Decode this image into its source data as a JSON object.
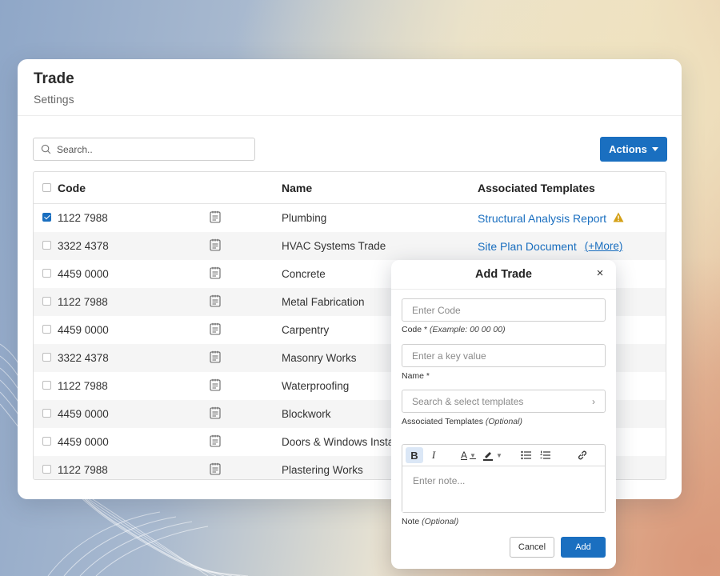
{
  "header": {
    "title": "Trade",
    "subtitle": "Settings"
  },
  "search": {
    "placeholder": "Search.."
  },
  "actions": {
    "label": "Actions"
  },
  "table": {
    "columns": {
      "code": "Code",
      "name": "Name",
      "templates": "Associated Templates"
    },
    "rows": [
      {
        "code": "1122 7988",
        "name": "Plumbing",
        "template": "Structural Analysis Report",
        "more": "",
        "checked": true,
        "warning": true
      },
      {
        "code": "3322 4378",
        "name": "HVAC Systems Trade",
        "template": "Site Plan Document",
        "more": "(+More)",
        "checked": false,
        "warning": false
      },
      {
        "code": "4459 0000",
        "name": "Concrete",
        "template": "",
        "more": "",
        "checked": false,
        "warning": false
      },
      {
        "code": "1122 7988",
        "name": "Metal Fabrication",
        "template": "",
        "more": "",
        "checked": false,
        "warning": false
      },
      {
        "code": "4459 0000",
        "name": "Carpentry",
        "template": "",
        "more": "",
        "checked": false,
        "warning": false
      },
      {
        "code": "3322 4378",
        "name": "Masonry Works",
        "template": "",
        "more": "",
        "checked": false,
        "warning": false
      },
      {
        "code": "1122 7988",
        "name": "Waterproofing",
        "template": "",
        "more": "",
        "checked": false,
        "warning": false
      },
      {
        "code": "4459 0000",
        "name": "Blockwork",
        "template": "",
        "more": "",
        "checked": false,
        "warning": false
      },
      {
        "code": "4459 0000",
        "name": "Doors & Windows Insta",
        "template": "",
        "more": "",
        "checked": false,
        "warning": false
      },
      {
        "code": "1122 7988",
        "name": "Plastering Works",
        "template": "",
        "more": "",
        "checked": false,
        "warning": false
      }
    ]
  },
  "modal": {
    "title": "Add Trade",
    "close": "×",
    "code_placeholder": "Enter Code",
    "code_label": "Code *",
    "code_hint": "(Example: 00 00 00)",
    "name_placeholder": "Enter a key value",
    "name_label": "Name *",
    "templates_placeholder": "Search & select templates",
    "templates_label": "Associated Templates",
    "templates_hint": "(Optional)",
    "note_placeholder": "Enter note...",
    "note_label": "Note",
    "note_hint": "(Optional)",
    "cancel_label": "Cancel",
    "add_label": "Add",
    "toolbar": {
      "bold": "B",
      "italic": "I",
      "text_color": "A"
    }
  },
  "colors": {
    "accent": "#1a6fc0",
    "warning": "#d4a017"
  }
}
